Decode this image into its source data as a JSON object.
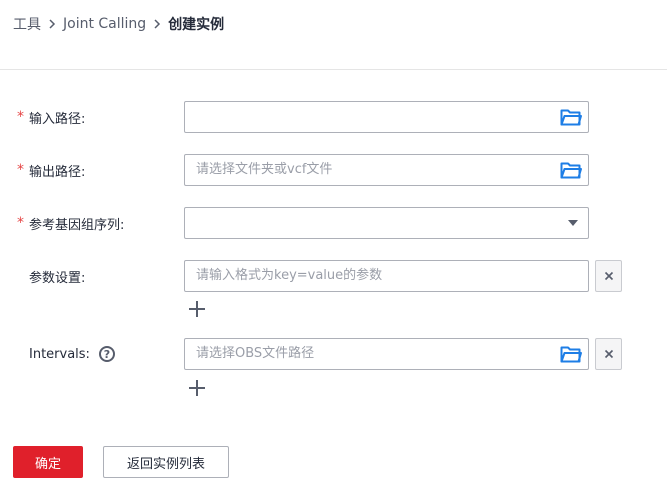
{
  "breadcrumb": {
    "items": [
      "工具",
      "Joint Calling",
      "创建实例"
    ]
  },
  "form": {
    "input_path": {
      "label": "输入路径:",
      "required": true,
      "placeholder": "",
      "icon": "folder-icon"
    },
    "output_path": {
      "label": "输出路径:",
      "required": true,
      "placeholder": "请选择文件夹或vcf文件",
      "icon": "folder-icon"
    },
    "reference_sequence": {
      "label": "参考基因组序列:",
      "required": true,
      "selected": "",
      "icon": "chevron-down-icon"
    },
    "params": {
      "label": "参数设置:",
      "required": false,
      "placeholder": "请输入格式为key=value的参数"
    },
    "intervals": {
      "label": "Intervals:",
      "required": false,
      "help_icon": "?",
      "placeholder": "请选择OBS文件路径",
      "icon": "folder-icon"
    }
  },
  "buttons": {
    "confirm": "确定",
    "back": "返回实例列表"
  },
  "colors": {
    "primary": "#e0202b",
    "required": "#e54545",
    "folder": "#1e7ee6",
    "border": "#adb0b8"
  }
}
